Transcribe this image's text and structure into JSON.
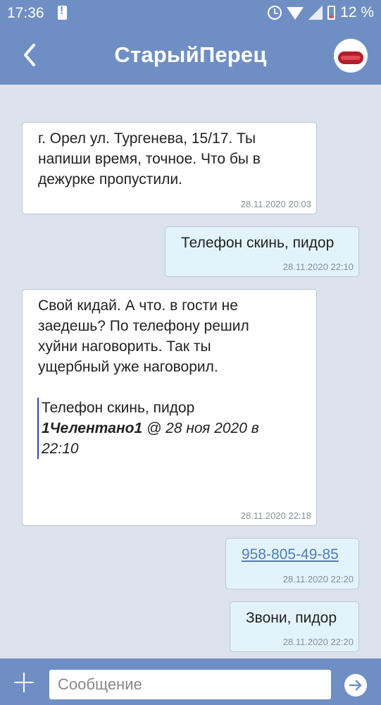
{
  "status_bar": {
    "time": "17:36",
    "battery": "12 %",
    "icons": [
      "warning-icon",
      "alarm-icon",
      "wifi-icon",
      "signal-icon",
      "battery-icon"
    ]
  },
  "header": {
    "title": "СтарыйПерец",
    "back_icon": "back-arrow-icon",
    "avatar": "avatar"
  },
  "colors": {
    "header_bg": "#6f8fc4",
    "chat_bg": "#dde3ec",
    "incoming_bubble": "#ffffff",
    "outgoing_bubble": "#e3f3fc",
    "link": "#4f7eb8",
    "quote_bar": "#3646a0"
  },
  "messages": [
    {
      "direction": "in",
      "lines": [
        "г. Орел ул. Тургенева, 15/17. Ты",
        "напиши время, точное. Что бы в",
        "дежурке пропустили."
      ],
      "time": "28.11.2020 20:03"
    },
    {
      "direction": "out",
      "text": "Телефон скинь, пидор",
      "time": "28.11.2020 22:10"
    },
    {
      "direction": "in",
      "lines": [
        "Свой кидай. А что. в гости не",
        "заедешь? По телефону решил",
        "хуйни наговорить. Так ты",
        "ущербный уже наговорил."
      ],
      "quote": {
        "text": "Телефон скинь, пидор",
        "author": "1Челентано1",
        "meta_line1": " @ 28 ноя 2020 в",
        "meta_line2": "22:10"
      },
      "time": "28.11.2020 22:18"
    },
    {
      "direction": "out",
      "link": "958-805-49-85",
      "time": "28.11.2020 22:20"
    },
    {
      "direction": "out",
      "text": "Звони, пидор",
      "time": "28.11.2020 22:20"
    }
  ],
  "composer": {
    "placeholder": "Сообщение",
    "add_icon": "plus-icon",
    "send_icon": "send-arrow-icon"
  }
}
